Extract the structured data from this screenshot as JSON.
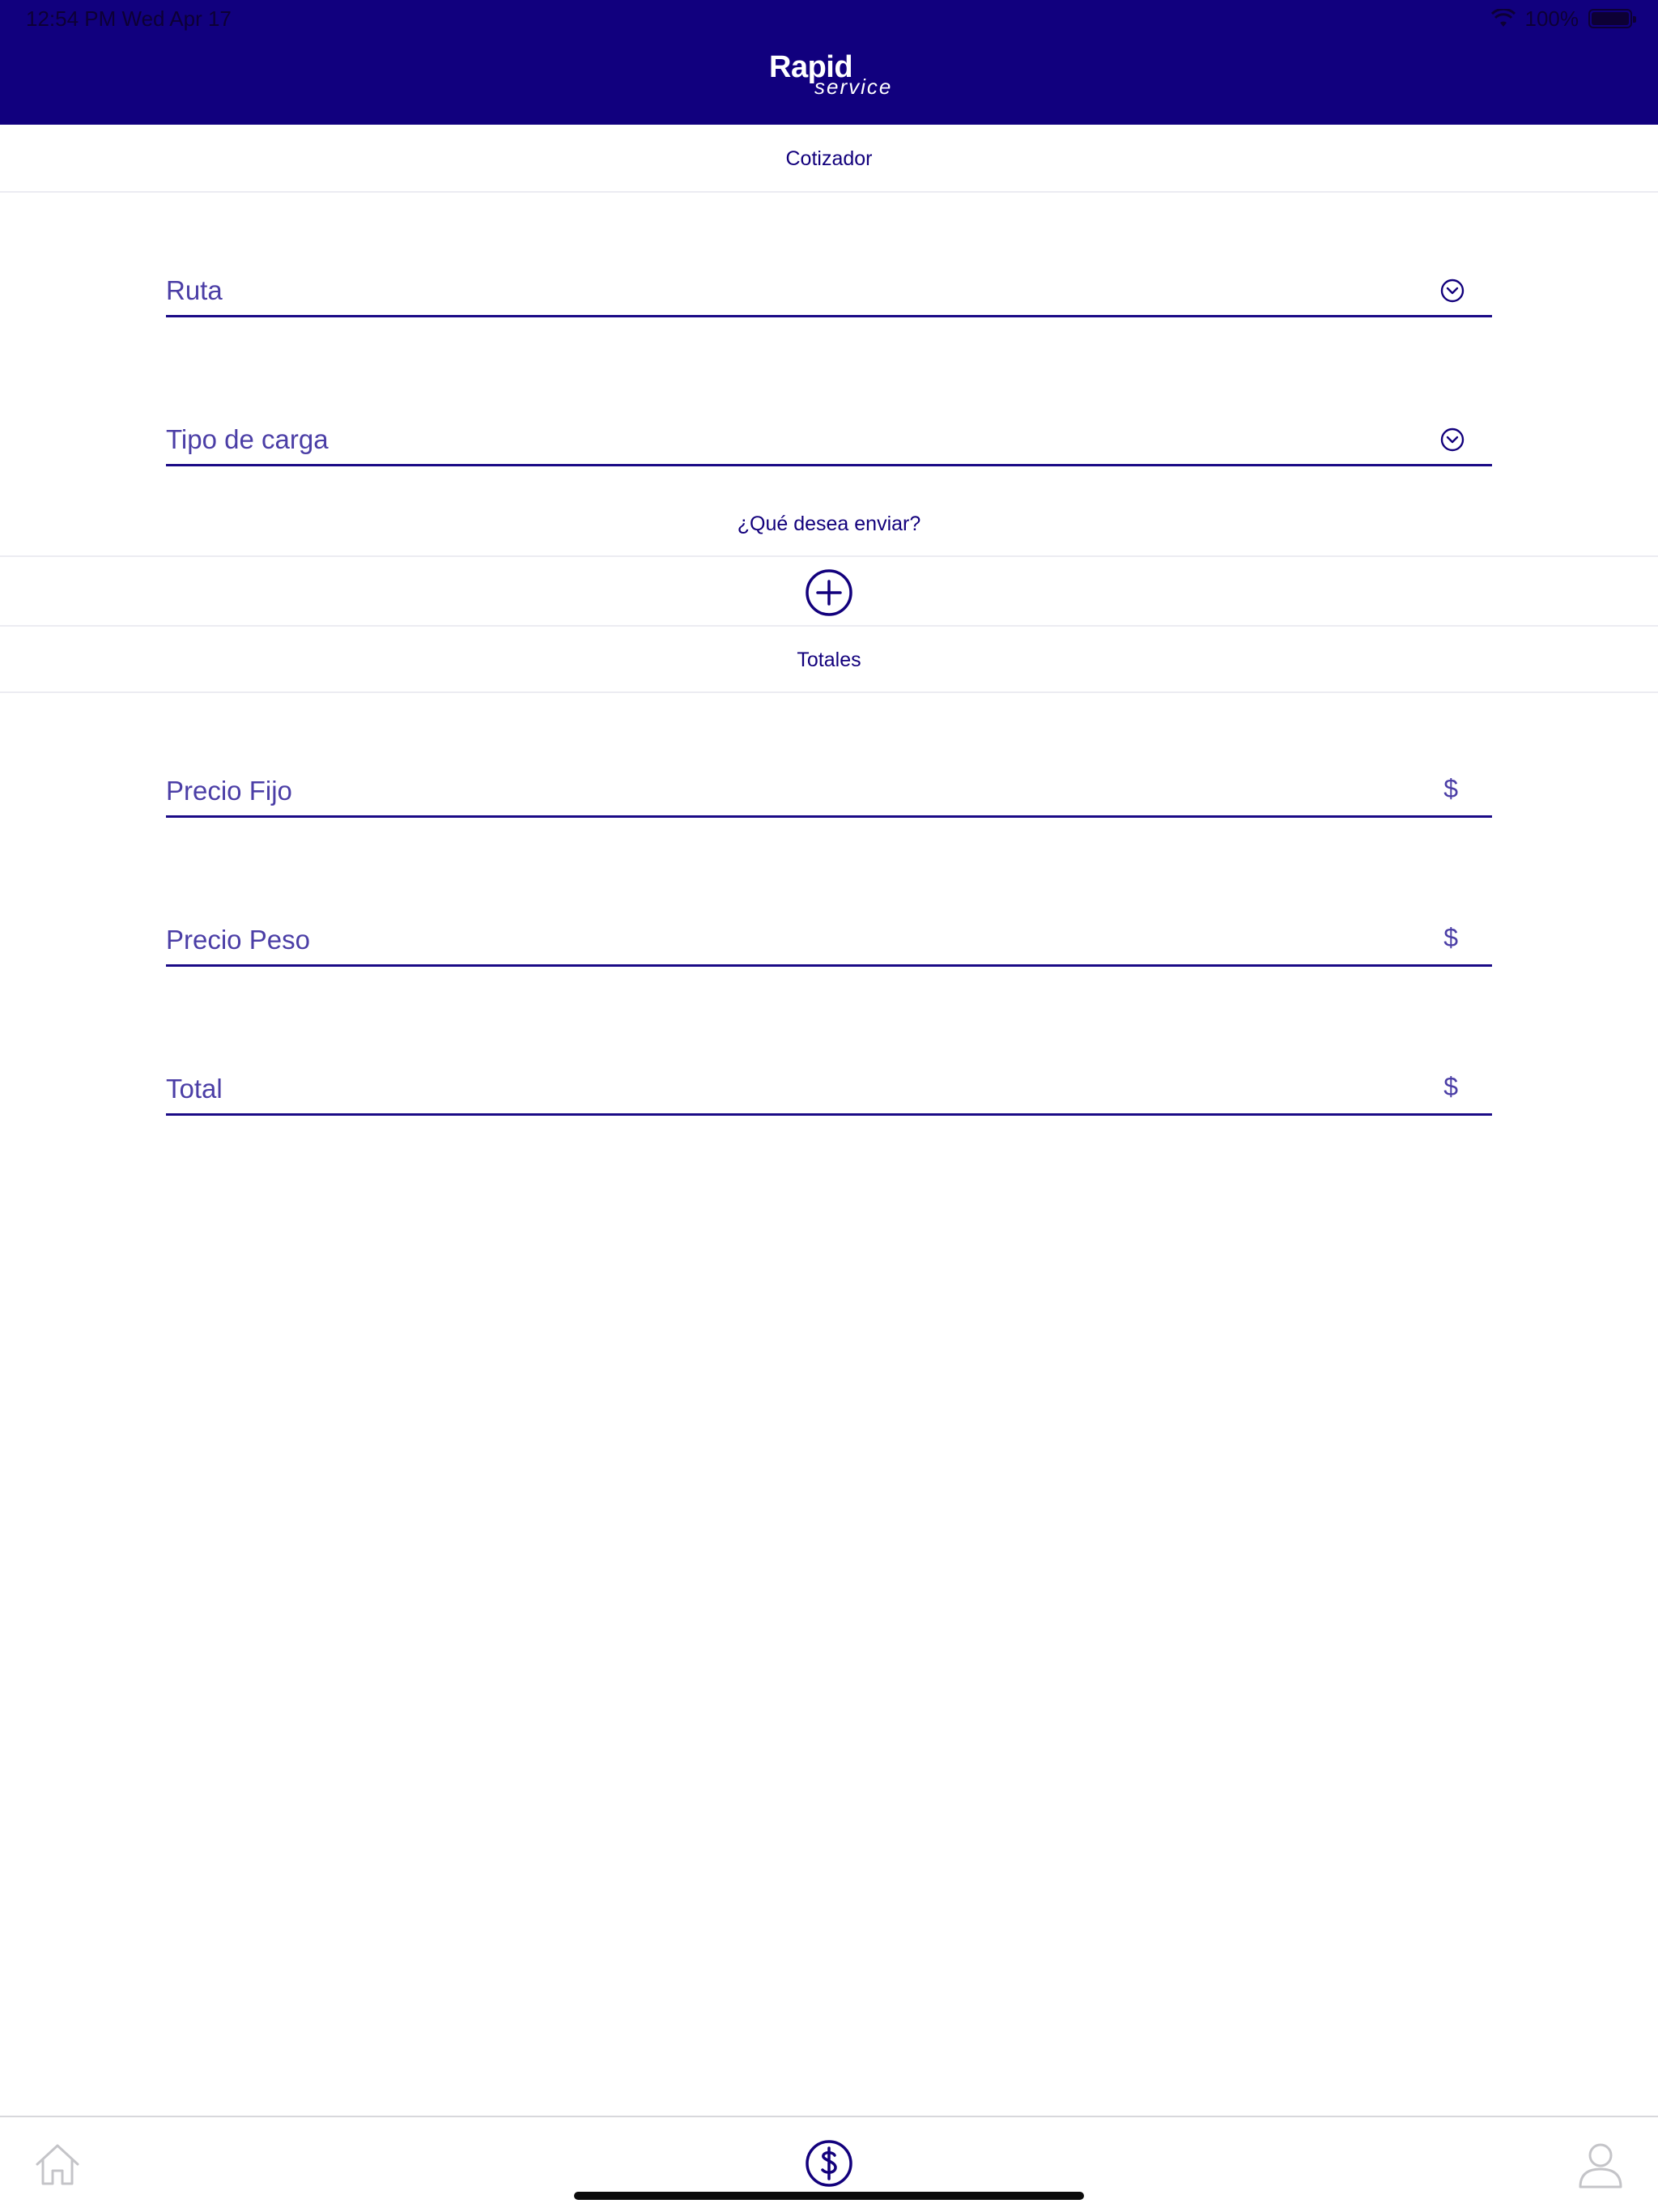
{
  "status": {
    "time": "12:54 PM   Wed Apr 17",
    "battery": "100%"
  },
  "header": {
    "logo_main": "Rapid",
    "logo_sub": "service"
  },
  "sections": {
    "cotizador": "Cotizador",
    "question": "¿Qué desea enviar?",
    "totales": "Totales"
  },
  "form": {
    "ruta": {
      "label": "Ruta",
      "icon": "chevron-down-circle-icon"
    },
    "tipo_carga": {
      "label": "Tipo de carga",
      "icon": "chevron-down-circle-icon"
    },
    "add_item_icon": "plus-circle-icon"
  },
  "totals": {
    "precio_fijo": {
      "label": "Precio Fijo",
      "currency": "$"
    },
    "precio_peso": {
      "label": "Precio Peso",
      "currency": "$"
    },
    "total": {
      "label": "Total",
      "currency": "$"
    }
  },
  "tabbar": {
    "items": [
      {
        "name": "home",
        "icon": "home-icon",
        "active": false
      },
      {
        "name": "quote",
        "icon": "dollar-circle-icon",
        "active": true
      },
      {
        "name": "profile",
        "icon": "user-icon",
        "active": false
      }
    ]
  },
  "colors": {
    "brand": "#11007e",
    "label": "#4b3ea6",
    "inactive_icon": "#c4c4c8",
    "divider": "#ececf2"
  }
}
